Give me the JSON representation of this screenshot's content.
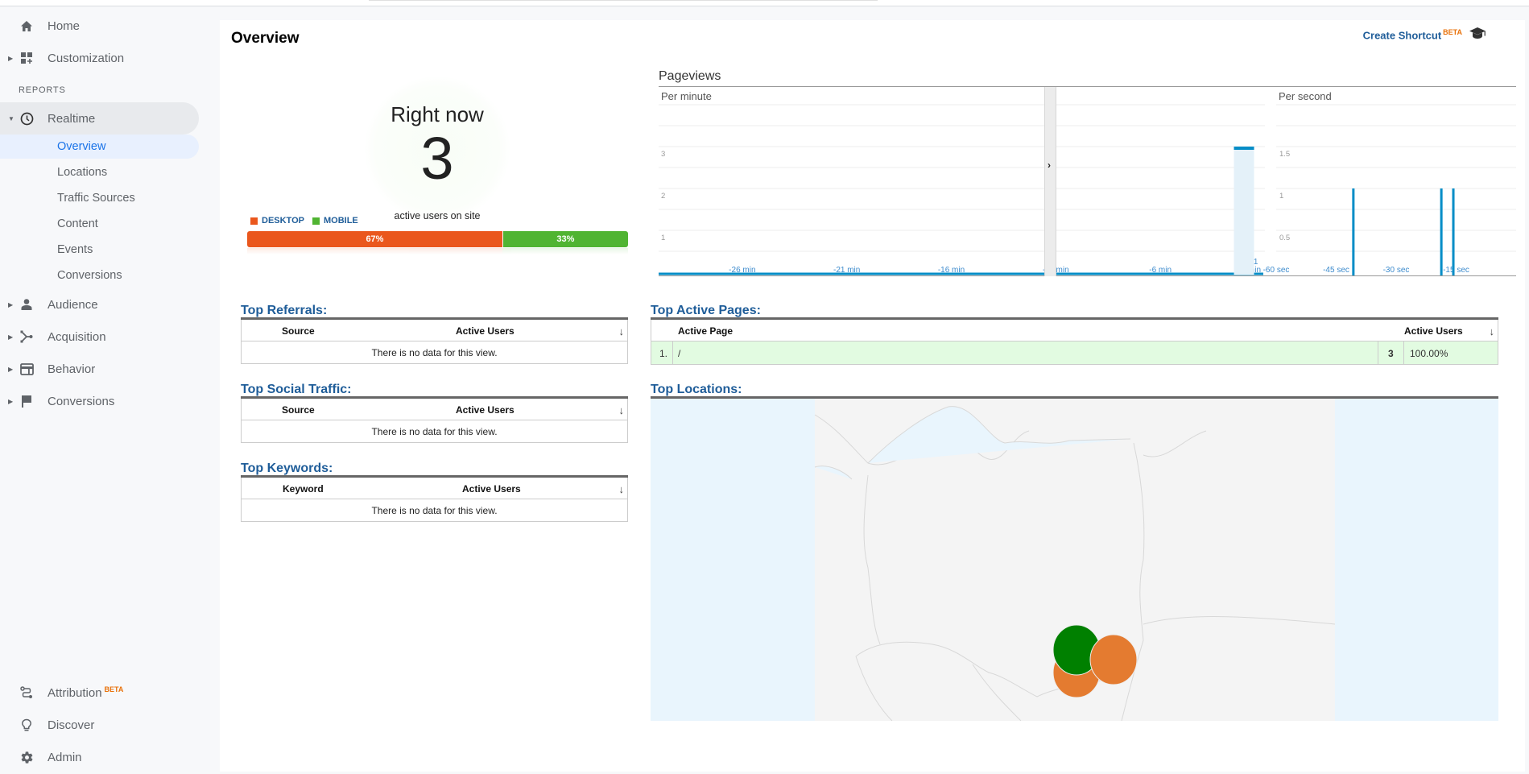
{
  "sidebar": {
    "top_items": [
      {
        "label": "Home",
        "icon": "home-icon"
      },
      {
        "label": "Customization",
        "icon": "dashboard-icon"
      }
    ],
    "section_label": "REPORTS",
    "realtime": {
      "label": "Realtime",
      "icon": "clock-icon"
    },
    "realtime_sub": [
      {
        "label": "Overview",
        "selected": true
      },
      {
        "label": "Locations"
      },
      {
        "label": "Traffic Sources"
      },
      {
        "label": "Content"
      },
      {
        "label": "Events"
      },
      {
        "label": "Conversions"
      }
    ],
    "report_items": [
      {
        "label": "Audience",
        "icon": "person-icon"
      },
      {
        "label": "Acquisition",
        "icon": "acquisition-icon"
      },
      {
        "label": "Behavior",
        "icon": "behavior-icon"
      },
      {
        "label": "Conversions",
        "icon": "flag-icon"
      }
    ],
    "bottom_items": [
      {
        "label": "Attribution",
        "badge": "BETA",
        "icon": "attribution-icon"
      },
      {
        "label": "Discover",
        "icon": "lightbulb-icon"
      },
      {
        "label": "Admin",
        "icon": "gear-icon"
      }
    ]
  },
  "header": {
    "title": "Overview",
    "shortcut_label": "Create Shortcut",
    "shortcut_badge": "BETA"
  },
  "right_now": {
    "title": "Right now",
    "active_users": "3",
    "subtitle": "active users on site",
    "devices": [
      {
        "label": "DESKTOP",
        "percent": 67,
        "percent_label": "67%",
        "color": "#ea571d"
      },
      {
        "label": "MOBILE",
        "percent": 33,
        "percent_label": "33%",
        "color": "#50b432"
      }
    ]
  },
  "pageviews": {
    "title": "Pageviews",
    "per_minute_label": "Per minute",
    "per_second_label": "Per second"
  },
  "chart_data": [
    {
      "type": "bar",
      "title": "Pageviews - Per minute",
      "x_tick_labels": [
        "-26 min",
        "-21 min",
        "-16 min",
        "-11 min",
        "-6 min",
        "-1 min"
      ],
      "y_ticks": [
        1,
        2,
        3
      ],
      "ylim": [
        0,
        4
      ],
      "x_range": [
        -30,
        -1
      ],
      "values": [
        {
          "x": -2,
          "y": 3,
          "highlighted": true
        }
      ],
      "color": "#058dc7",
      "grid": true
    },
    {
      "type": "bar",
      "title": "Pageviews - Per second",
      "x_tick_labels": [
        "-60 sec",
        "-45 sec",
        "-30 sec",
        "-15 sec"
      ],
      "y_ticks": [
        0.5,
        1,
        1.5
      ],
      "ylim": [
        0,
        2
      ],
      "x_range": [
        -60,
        0
      ],
      "values": [
        {
          "x": -41,
          "y": 1
        },
        {
          "x": -19,
          "y": 1
        },
        {
          "x": -16,
          "y": 1
        }
      ],
      "color": "#058dc7",
      "grid": true
    }
  ],
  "tables": {
    "referrals": {
      "title": "Top Referrals:",
      "col1": "Source",
      "col2": "Active Users",
      "empty": "There is no data for this view."
    },
    "social": {
      "title": "Top Social Traffic:",
      "col1": "Source",
      "col2": "Active Users",
      "empty": "There is no data for this view."
    },
    "keywords": {
      "title": "Top Keywords:",
      "col1": "Keyword",
      "col2": "Active Users",
      "empty": "There is no data for this view."
    },
    "active_pages": {
      "title": "Top Active Pages:",
      "col1": "Active Page",
      "col2": "Active Users",
      "rows": [
        {
          "index": "1.",
          "page": "/",
          "users": "3",
          "percent": "100.00%"
        }
      ]
    }
  },
  "locations": {
    "title": "Top Locations:",
    "markers": [
      {
        "color": "#e47b30"
      },
      {
        "color": "#e47b30"
      },
      {
        "color": "#008000"
      }
    ]
  }
}
